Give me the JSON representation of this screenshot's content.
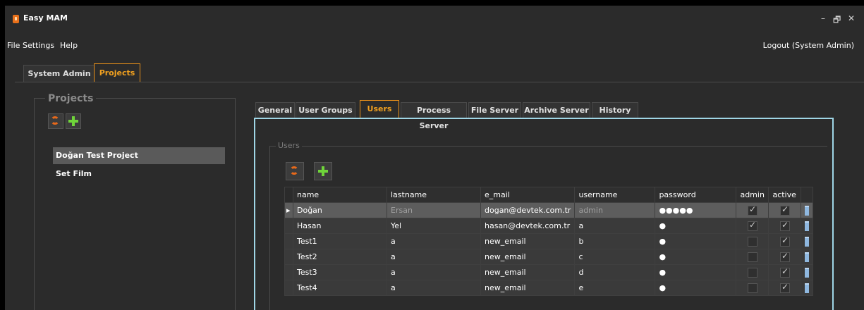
{
  "window": {
    "title": "Easy MAM",
    "controls": {
      "minimize": "–",
      "maximize": "🗗",
      "close": "✕"
    }
  },
  "menu": {
    "items": [
      "File",
      "Settings",
      "Help"
    ],
    "logout": "Logout (System Admin)"
  },
  "top_tabs": [
    {
      "label": "System Admin",
      "active": false
    },
    {
      "label": "Projects",
      "active": true
    }
  ],
  "projects_panel": {
    "title": "Projects",
    "refresh_icon": "refresh-icon",
    "add_icon": "add-icon",
    "items": [
      {
        "label": "Doğan Test Project",
        "selected": true
      },
      {
        "label": "Set Film",
        "selected": false
      }
    ]
  },
  "inner_tabs": [
    {
      "label": "General",
      "active": false
    },
    {
      "label": "User Groups",
      "active": false
    },
    {
      "label": "Users",
      "active": true
    },
    {
      "label": "Process Server",
      "active": false
    },
    {
      "label": "File Server",
      "active": false
    },
    {
      "label": "Archive Server",
      "active": false
    },
    {
      "label": "History",
      "active": false
    }
  ],
  "users_group": {
    "title": "Users",
    "columns": [
      "name",
      "lastname",
      "e_mail",
      "username",
      "password",
      "admin",
      "active"
    ],
    "rows": [
      {
        "name": "Doğan",
        "lastname": "Ersan",
        "e_mail": "dogan@devtek.com.tr",
        "username": "admin",
        "password": "●●●●●",
        "admin": true,
        "active": true,
        "selected": true,
        "row_marker": "▸"
      },
      {
        "name": "Hasan",
        "lastname": "Yel",
        "e_mail": "hasan@devtek.com.tr",
        "username": "a",
        "password": "●",
        "admin": true,
        "active": true
      },
      {
        "name": "Test1",
        "lastname": "a",
        "e_mail": "new_email",
        "username": "b",
        "password": "●",
        "admin": false,
        "active": true
      },
      {
        "name": "Test2",
        "lastname": "a",
        "e_mail": "new_email",
        "username": "c",
        "password": "●",
        "admin": false,
        "active": true
      },
      {
        "name": "Test3",
        "lastname": "a",
        "e_mail": "new_email",
        "username": "d",
        "password": "●",
        "admin": false,
        "active": true
      },
      {
        "name": "Test4",
        "lastname": "a",
        "e_mail": "new_email",
        "username": "e",
        "password": "●",
        "admin": false,
        "active": true
      }
    ]
  },
  "colors": {
    "accent": "#f0a020",
    "active_border": "#e8901a",
    "content_border": "#9fd6e6",
    "add_green": "#6fd43a",
    "refresh_orange": "#e8691a"
  }
}
